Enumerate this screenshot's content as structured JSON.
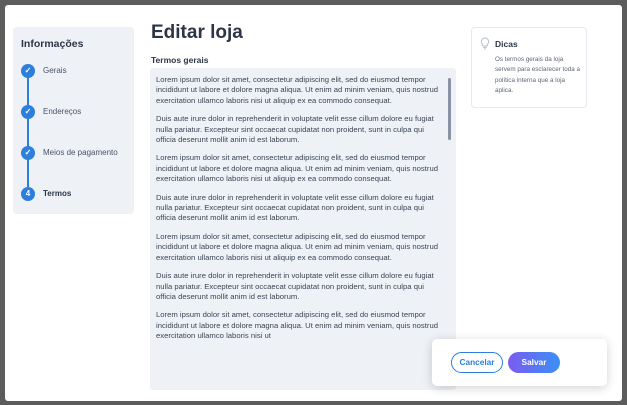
{
  "stepper": {
    "title": "Informações",
    "steps": [
      {
        "label": "Gerais",
        "marker": "✓",
        "state": "done"
      },
      {
        "label": "Endereços",
        "marker": "✓",
        "state": "done"
      },
      {
        "label": "Meios de pagamento",
        "marker": "✓",
        "state": "done"
      },
      {
        "label": "Termos",
        "marker": "4",
        "state": "active"
      }
    ]
  },
  "main": {
    "title": "Editar loja",
    "terms_label": "Termos gerais",
    "terms_paragraphs": [
      "Lorem ipsum dolor sit amet, consectetur adipiscing elit, sed do eiusmod tempor incididunt ut labore et dolore magna aliqua. Ut enim ad minim veniam, quis nostrud exercitation ullamco laboris nisi ut aliquip ex ea commodo consequat.",
      "Duis aute irure dolor in reprehenderit in voluptate velit esse cillum dolore eu fugiat nulla pariatur. Excepteur sint occaecat cupidatat non proident, sunt in culpa qui officia deserunt mollit anim id est laborum.",
      "Lorem ipsum dolor sit amet, consectetur adipiscing elit, sed do eiusmod tempor incididunt ut labore et dolore magna aliqua. Ut enim ad minim veniam, quis nostrud exercitation ullamco laboris nisi ut aliquip ex ea commodo consequat.",
      "Duis aute irure dolor in reprehenderit in voluptate velit esse cillum dolore eu fugiat nulla pariatur. Excepteur sint occaecat cupidatat non proident, sunt in culpa qui officia deserunt mollit anim id est laborum.",
      "Lorem ipsum dolor sit amet, consectetur adipiscing elit, sed do eiusmod tempor incididunt ut labore et dolore magna aliqua. Ut enim ad minim veniam, quis nostrud exercitation ullamco laboris nisi ut aliquip ex ea commodo consequat.",
      "Duis aute irure dolor in reprehenderit in voluptate velit esse cillum dolore eu fugiat nulla pariatur. Excepteur sint occaecat cupidatat non proident, sunt in culpa qui officia deserunt mollit anim id est laborum.",
      "Lorem ipsum dolor sit amet, consectetur adipiscing elit, sed do eiusmod tempor incididunt ut labore et dolore magna aliqua. Ut enim ad minim veniam, quis nostrud exercitation ullamco laboris nisi ut"
    ]
  },
  "tips": {
    "icon": "lightbulb-icon",
    "title": "Dicas",
    "text": "Os termos gerais da loja servem para esclarecer toda a política interna que a loja aplica."
  },
  "actions": {
    "cancel_label": "Cancelar",
    "save_label": "Salvar"
  },
  "colors": {
    "accent": "#2d7fdd",
    "save_gradient_start": "#7b5cf0",
    "save_gradient_end": "#3a8ff5",
    "panel_bg": "#eef1f6"
  }
}
